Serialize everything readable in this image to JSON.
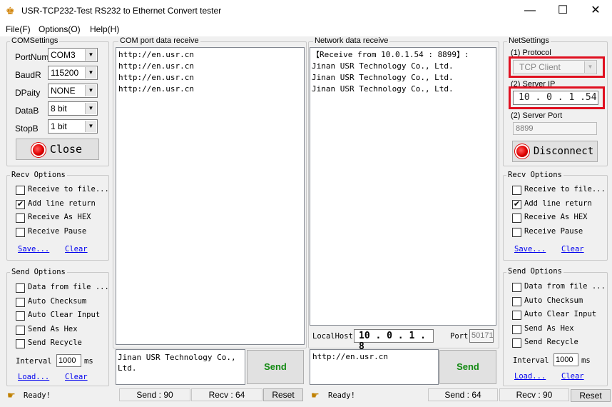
{
  "window": {
    "title": "USR-TCP232-Test  RS232 to Ethernet Convert tester",
    "minimize": "—",
    "maximize": "☐",
    "close": "✕"
  },
  "menu": [
    "File(F)",
    "Options(O)",
    "Help(H)"
  ],
  "com_settings": {
    "title": "COMSettings",
    "port_label": "PortNum",
    "port_value": "COM3",
    "baud_label": "BaudR",
    "baud_value": "115200",
    "parity_label": "DPaity",
    "parity_value": "NONE",
    "data_label": "DataB",
    "data_value": "8 bit",
    "stop_label": "StopB",
    "stop_value": "1 bit",
    "close_button": "Close"
  },
  "com_recv": {
    "title": "Recv Options",
    "options": [
      {
        "label": "Receive to file...",
        "checked": false
      },
      {
        "label": "Add line return",
        "checked": true
      },
      {
        "label": "Receive As HEX",
        "checked": false
      },
      {
        "label": "Receive Pause",
        "checked": false
      }
    ],
    "save_link": "Save...",
    "clear_link": "Clear"
  },
  "com_send": {
    "title": "Send Options",
    "options": [
      {
        "label": "Data from file ...",
        "checked": false
      },
      {
        "label": "Auto Checksum",
        "checked": false
      },
      {
        "label": "Auto Clear Input",
        "checked": false
      },
      {
        "label": "Send As Hex",
        "checked": false
      },
      {
        "label": "Send Recycle",
        "checked": false
      }
    ],
    "interval_label": "Interval",
    "interval_value": "1000",
    "interval_unit": "ms",
    "load_link": "Load...",
    "clear_link": "Clear"
  },
  "com_data": {
    "title": "COM port data receive",
    "lines": [
      "http://en.usr.cn",
      "http://en.usr.cn",
      "http://en.usr.cn",
      "http://en.usr.cn"
    ],
    "send_text": "Jinan USR Technology Co.,\nLtd.",
    "send_button": "Send"
  },
  "net_data": {
    "title": "Network data receive",
    "lines": [
      "【Receive from 10.0.1.54 : 8899】:",
      "Jinan USR Technology Co., Ltd.",
      "Jinan USR Technology Co., Ltd.",
      "Jinan USR Technology Co., Ltd."
    ],
    "localhost_label": "LocalHost",
    "localhost_value": "10 . 0 . 1 . 8",
    "port_label": "Port",
    "port_value": "50171",
    "send_text": "http://en.usr.cn",
    "send_button": "Send"
  },
  "net_settings": {
    "title": "NetSettings",
    "protocol_label": "(1) Protocol",
    "protocol_value": "TCP Client",
    "server_ip_label": "(2) Server IP",
    "server_ip_value": "10 . 0 . 1 .54",
    "server_port_label": "(2) Server Port",
    "server_port_value": "8899",
    "disconnect_button": "Disconnect"
  },
  "net_recv": {
    "title": "Recv Options",
    "options": [
      {
        "label": "Receive to file...",
        "checked": false
      },
      {
        "label": "Add line return",
        "checked": true
      },
      {
        "label": "Receive As HEX",
        "checked": false
      },
      {
        "label": "Receive Pause",
        "checked": false
      }
    ],
    "save_link": "Save...",
    "clear_link": "Clear"
  },
  "net_send": {
    "title": "Send Options",
    "options": [
      {
        "label": "Data from file ...",
        "checked": false
      },
      {
        "label": "Auto Checksum",
        "checked": false
      },
      {
        "label": "Auto Clear Input",
        "checked": false
      },
      {
        "label": "Send As Hex",
        "checked": false
      },
      {
        "label": "Send Recycle",
        "checked": false
      }
    ],
    "interval_label": "Interval",
    "interval_value": "1000",
    "interval_unit": "ms",
    "load_link": "Load...",
    "clear_link": "Clear"
  },
  "status": {
    "left_ready": "Ready!",
    "com_send": "Send : 90",
    "com_recv": "Recv : 64",
    "reset": "Reset",
    "right_ready": "Ready!",
    "net_send": "Send : 64",
    "net_recv": "Recv : 90"
  },
  "icons": {
    "app": "app-icon",
    "led": "red-led-icon",
    "status": "hand-pointer-icon",
    "check": "✔",
    "arrow": "▼"
  }
}
